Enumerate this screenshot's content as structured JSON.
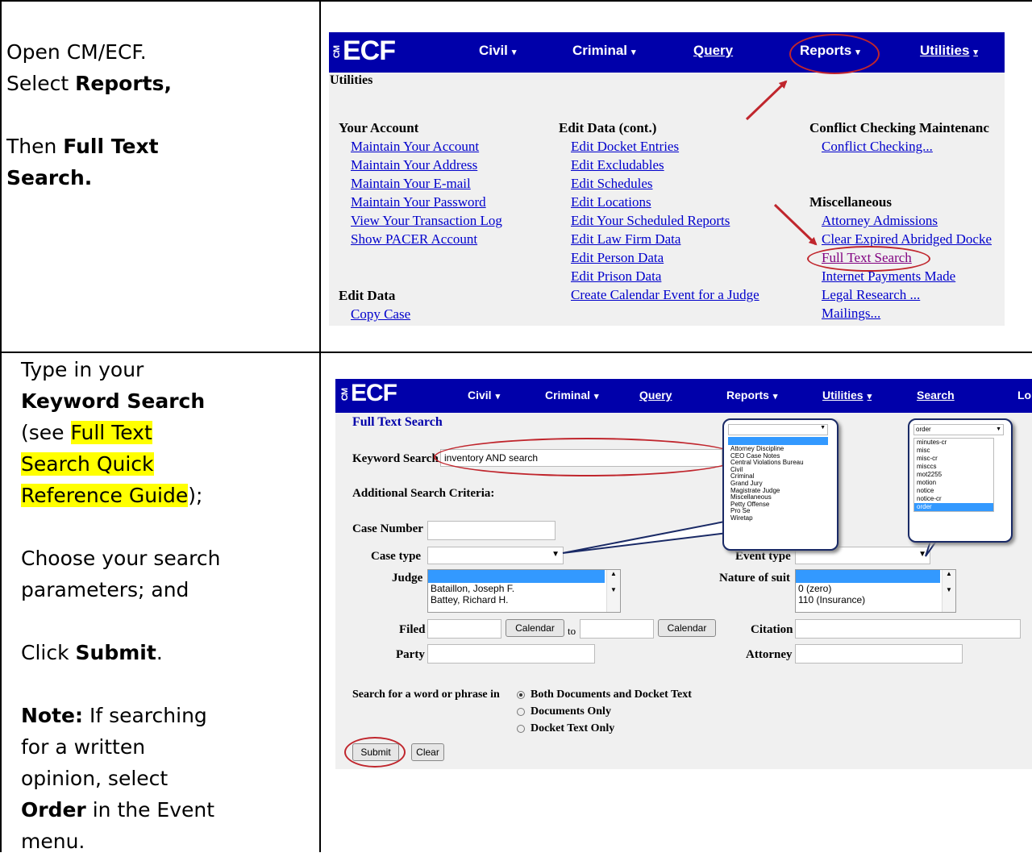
{
  "step1": {
    "instructions": {
      "line1": "Open CM/ECF.",
      "line2_pre": "Select ",
      "line2_bold": "Reports,",
      "line3_pre": "Then ",
      "line3_bold": "Full Text",
      "line4_bold": "Search."
    },
    "navbar": {
      "logo_prefix": "CM",
      "logo": "ECF",
      "items": [
        {
          "label": "Civil",
          "caret": "▾"
        },
        {
          "label": "Criminal",
          "caret": "▾"
        },
        {
          "label": "Query",
          "caret": ""
        },
        {
          "label": "Reports",
          "caret": "▾"
        },
        {
          "label": "Utilities",
          "caret": "▾"
        }
      ]
    },
    "page_title": "Utilities",
    "your_account": {
      "heading": "Your Account",
      "links": [
        "Maintain Your Account",
        "Maintain Your Address",
        "Maintain Your E-mail",
        "Maintain Your Password",
        "View Your Transaction Log",
        "Show PACER Account"
      ]
    },
    "edit_data": {
      "heading": "Edit Data",
      "links": [
        "Copy Case"
      ]
    },
    "edit_data_cont": {
      "heading": "Edit Data (cont.)",
      "links": [
        "Edit Docket Entries",
        "Edit Excludables",
        "Edit Schedules",
        "Edit Locations",
        "Edit Your Scheduled Reports",
        "Edit Law Firm Data",
        "Edit Person Data",
        "Edit Prison Data",
        "Create Calendar Event for a Judge"
      ]
    },
    "conflict": {
      "heading": "Conflict Checking Maintenanc",
      "links": [
        "Conflict Checking..."
      ]
    },
    "misc": {
      "heading": "Miscellaneous",
      "links": [
        "Attorney Admissions",
        "Clear Expired Abridged Docke",
        "Full Text Search",
        "Internet Payments Made",
        "Legal Research ...",
        "Mailings..."
      ]
    }
  },
  "step2": {
    "instructions": {
      "l1": "Type in your",
      "l2": "Keyword Search",
      "l3_pre": "(see ",
      "l3_hl": "Full Text",
      "l4_hl": "Search Quick",
      "l5_hl": "Reference Guide",
      "l5_post": ");",
      "l6": "Choose your search",
      "l7": "parameters; and",
      "l8_pre": "Click ",
      "l8_bold": "Submit",
      "l8_post": ".",
      "l9_bold": "Note:",
      "l9_post": "  If searching",
      "l10": "for a written",
      "l11": "opinion, select",
      "l12_bold": "Order",
      "l12_post": " in the Event",
      "l13": "menu."
    },
    "navbar": {
      "logo_prefix": "CM",
      "logo": "ECF",
      "items": [
        {
          "label": "Civil",
          "caret": "▾"
        },
        {
          "label": "Criminal",
          "caret": "▾"
        },
        {
          "label": "Query",
          "caret": ""
        },
        {
          "label": "Reports",
          "caret": "▾"
        },
        {
          "label": "Utilities",
          "caret": "▾"
        },
        {
          "label": "Search",
          "caret": ""
        },
        {
          "label": "Lo",
          "caret": ""
        }
      ]
    },
    "form": {
      "title": "Full Text Search",
      "keyword_label": "Keyword Search",
      "keyword_value": "inventory AND search",
      "additional_label": "Additional Search Criteria:",
      "case_number_label": "Case Number",
      "case_number_value": "",
      "case_type_label": "Case type",
      "event_type_label": "Event type",
      "judge_label": "Judge",
      "judges": [
        "",
        "Bataillon, Joseph F.",
        "Battey, Richard H."
      ],
      "nature_label": "Nature of suit",
      "natures": [
        "",
        "0 (zero)",
        "110 (Insurance)"
      ],
      "filed_label": "Filed",
      "filed_from": "",
      "calendar_label": "Calendar",
      "to_label": "to",
      "filed_to": "",
      "citation_label": "Citation",
      "party_label": "Party",
      "attorney_label": "Attorney",
      "search_in_label": "Search for a word or phrase in",
      "options": [
        "Both Documents and Docket Text",
        "Documents Only",
        "Docket Text Only"
      ],
      "selected_option": "Both Documents and Docket Text",
      "submit_label": "Submit",
      "clear_label": "Clear"
    },
    "case_type_popup": {
      "items": [
        "Attorney Discipline",
        "CEO Case Notes",
        "Central Violations Bureau",
        "Civil",
        "Criminal",
        "Grand Jury",
        "Magistrate Judge",
        "Miscellaneous",
        "Petty Offense",
        "Pro Se",
        "Wiretap"
      ]
    },
    "event_popup": {
      "selected": "order",
      "items": [
        "minutes-cr",
        "misc",
        "misc-cr",
        "misccs",
        "mot2255",
        "motion",
        "notice",
        "notice-cr",
        "order"
      ]
    }
  },
  "colors": {
    "navbar_bg": "#0000aa",
    "link": "#0000cc",
    "highlight": "#ffff00",
    "annotation": "#c0262d",
    "page_bg": "#f0f0f0"
  }
}
